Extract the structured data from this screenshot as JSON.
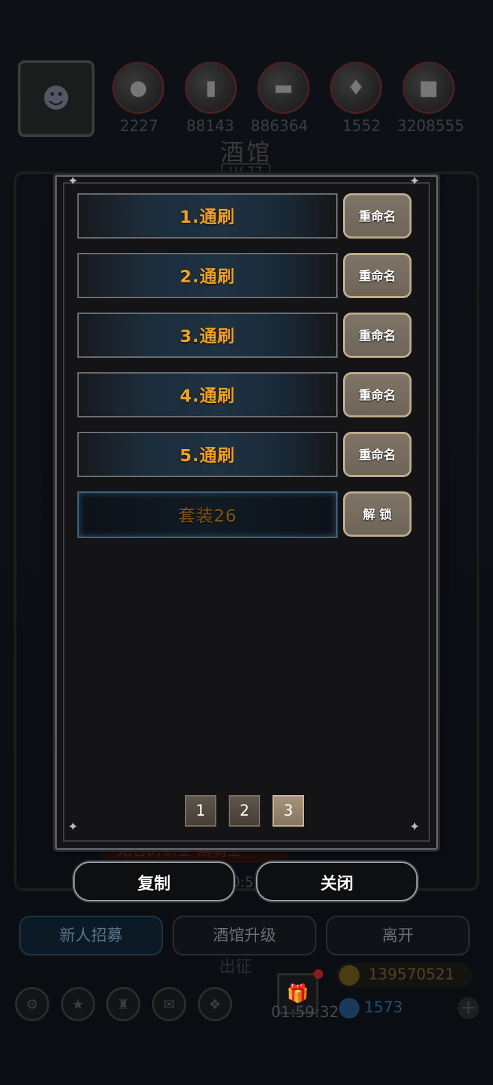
{
  "background": {
    "resources": [
      {
        "icon": "portrait-icon",
        "value": ""
      },
      {
        "icon": "meat-icon",
        "value": "2227"
      },
      {
        "icon": "wood-icon",
        "value": "88143"
      },
      {
        "icon": "iron-icon",
        "value": "886364"
      },
      {
        "icon": "crystal-icon",
        "value": "1552"
      },
      {
        "icon": "stone-icon",
        "value": "3208555"
      }
    ],
    "tavern_title": "酒馆",
    "tavern_level": "LV 77",
    "hero_name_strip": "无名的剑士·黑骑士",
    "timer_partial": "0:5",
    "bottom_buttons": [
      "新人招募",
      "酒馆升级",
      "离开"
    ],
    "dispatch_label": "出征",
    "countdown": "01:59:32",
    "gold": "139570521",
    "gems": "1573"
  },
  "modal": {
    "slots": [
      {
        "label": "1.通刷",
        "action": "重命名"
      },
      {
        "label": "2.通刷",
        "action": "重命名"
      },
      {
        "label": "3.通刷",
        "action": "重命名"
      },
      {
        "label": "4.通刷",
        "action": "重命名"
      },
      {
        "label": "5.通刷",
        "action": "重命名"
      },
      {
        "label": "套装26",
        "action": "解 锁",
        "locked": true
      }
    ],
    "pages": [
      "1",
      "2",
      "3"
    ],
    "active_page": "3",
    "copy_label": "复制",
    "close_label": "关闭"
  },
  "colors": {
    "slot_text": "#f1a022",
    "locked_text": "#7a5616",
    "button_bg": "#7e7466"
  }
}
